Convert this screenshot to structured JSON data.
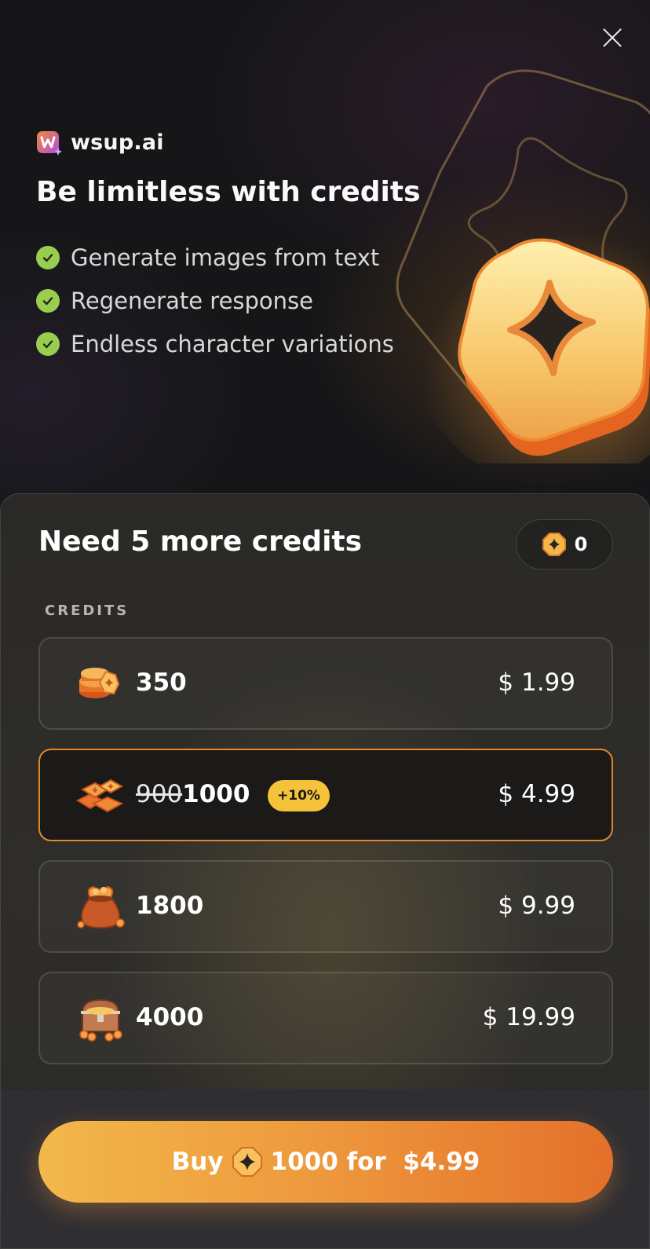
{
  "brand": {
    "name": "wsup.ai",
    "logo_icon": "w-logo-icon"
  },
  "hero": {
    "title": "Be limitless with credits",
    "features": [
      {
        "text": "Generate images from text",
        "icon": "check-circle-icon"
      },
      {
        "text": "Regenerate response",
        "icon": "check-circle-icon"
      },
      {
        "text": "Endless character variations",
        "icon": "check-circle-icon"
      }
    ],
    "close_icon": "close-icon"
  },
  "sheet": {
    "title": "Need 5 more credits",
    "balance": "0",
    "section_label": "CREDITS"
  },
  "packages": [
    {
      "old_amount": "",
      "amount": "350",
      "badge": "",
      "price": "$ 1.99",
      "icon": "coin-stack-icon",
      "selected": false
    },
    {
      "old_amount": "900",
      "amount": "1000",
      "badge": "+10%",
      "price": "$ 4.99",
      "icon": "coin-pile-icon",
      "selected": true
    },
    {
      "old_amount": "",
      "amount": "1800",
      "badge": "",
      "price": "$ 9.99",
      "icon": "coin-bag-icon",
      "selected": false
    },
    {
      "old_amount": "",
      "amount": "4000",
      "badge": "",
      "price": "$ 19.99",
      "icon": "treasure-chest-icon",
      "selected": false
    }
  ],
  "buy": {
    "prefix": "Buy",
    "suffix": "1000 for  $4.99"
  },
  "colors": {
    "accent": "#e5862e",
    "check": "#9acd4f",
    "badge": "#f5c33a"
  }
}
